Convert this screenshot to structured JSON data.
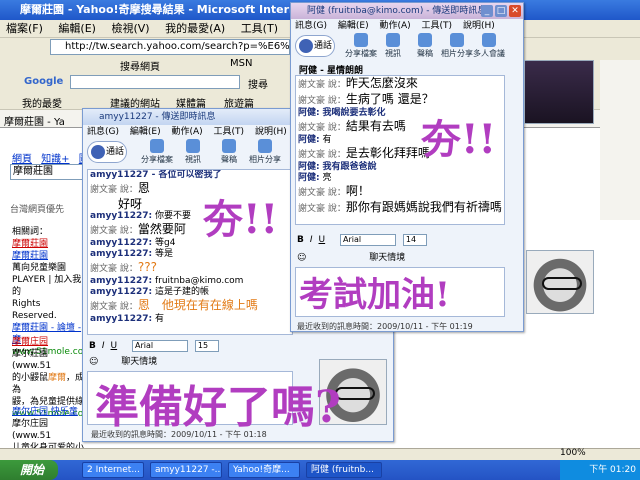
{
  "browser": {
    "title": "摩爾莊園 - Yahoo!奇摩搜尋結果 - Microsoft Internet Explorer",
    "menu": [
      "檔案(F)",
      "編輯(E)",
      "檢視(V)",
      "我的最愛(A)",
      "工具(T)"
    ],
    "address": "http://tw.search.yahoo.com/search?p=%E6%91%A9%E7",
    "search_label": "搜尋網頁",
    "msn_label": "MSN",
    "google_label": "Google",
    "google_search_label": "搜尋",
    "favorites_label": "我的最愛",
    "fav_items": [
      "建議的網站",
      "媒體篇",
      "旅遊篇"
    ],
    "tab_label": "摩爾莊園 - Ya",
    "nav_tabs": [
      "網頁",
      "知識+",
      "圖片"
    ],
    "query_value": "摩爾莊園",
    "related_label": "台灣網頁優先",
    "results": [
      {
        "lines": [
          "相關詞：",
          "摩爾莊園",
          "摩爾莊園",
          "萬向兒童樂園",
          "PLAYER | 加入我的",
          "Rights Reserved.",
          "摩爾莊園 - 論壇 - 摩",
          "www.51mole.com"
        ]
      },
      {
        "lines": [
          "摩爾庄园",
          "摩尔莊園(www.51",
          "的小鼹鼠",
          "摩爾",
          "，成為",
          "鼹，為兒童提供綠",
          "www.51mole.com"
        ]
      },
      {
        "lines": [
          "摩尔庄园 快乐童",
          "摩尔庄园(www.51",
          "儿童化身可爱的小鼹"
        ]
      }
    ],
    "status": ""
  },
  "win1": {
    "title": "amyy11227 - 傳送即時訊息",
    "menu": [
      "訊息(G)",
      "編輯(E)",
      "動作(A)",
      "工具(T)",
      "說明(H)"
    ],
    "call_label": "通話",
    "tools": [
      "分享檔案",
      "視訊",
      "聲稿",
      "相片分享"
    ],
    "chat": [
      {
        "nick": "amyy11227 - 各位可以密我了",
        "msg": ""
      },
      {
        "nick": "謝文豪 說：",
        "msg": "恩"
      },
      {
        "nick": "",
        "msg": "好呀"
      },
      {
        "nick": "amyy11227:",
        "msg": "你要不要"
      },
      {
        "nick": "謝文豪 說：",
        "msg": "當然要阿"
      },
      {
        "nick": "amyy11227:",
        "msg": "等g4"
      },
      {
        "nick": "amyy11227:",
        "msg": "等是"
      },
      {
        "nick": "謝文豪 說：",
        "msg": "???"
      },
      {
        "nick": "amyy11227:",
        "msg": "fruitnba@kimo.com"
      },
      {
        "nick": "amyy11227:",
        "msg": "這是子建的帳"
      },
      {
        "nick": "謝文豪 說：",
        "msg": "恩　他現在有在線上嗎"
      },
      {
        "nick": "amyy11227:",
        "msg": "有"
      }
    ],
    "font": "Arial",
    "size": "15",
    "emote_label": "聊天情境",
    "last_msg": "最近收到的訊息時間：2009/10/11 - 下午 01:18",
    "handwriting_main": "夯!!",
    "handwriting_bottom": "準備好了嗎?"
  },
  "win2": {
    "title": "阿健 (fruitnba@kimo.com) - 傳送即時訊息",
    "menu": [
      "訊息(G)",
      "編輯(E)",
      "動作(A)",
      "工具(T)",
      "說明(H)"
    ],
    "call_label": "通話",
    "tools": [
      "分享檔案",
      "視訊",
      "聲稿",
      "相片分享",
      "多人會議"
    ],
    "to_label": "阿健 - 星情朗朗",
    "chat": [
      {
        "nick": "謝文豪 說：",
        "msg": "昨天怎麼沒來"
      },
      {
        "nick": "謝文豪 說：",
        "msg": "生病了嗎  還是？"
      },
      {
        "nick": "阿健:",
        "msg": "我喝說要去彰化"
      },
      {
        "nick": "謝文豪 說：",
        "msg": "結果有去嗎"
      },
      {
        "nick": "阿健:",
        "msg": "有"
      },
      {
        "nick": "謝文豪 說：",
        "msg": "是去彰化拜拜嗎"
      },
      {
        "nick": "阿健:",
        "msg": "我有跟爸爸說"
      },
      {
        "nick": "阿健:",
        "msg": "亮"
      },
      {
        "nick": "謝文豪 說：",
        "msg": "啊！"
      },
      {
        "nick": "謝文豪 說：",
        "msg": "那你有跟媽媽說我們有祈禱嗎"
      }
    ],
    "font": "Arial",
    "size": "14",
    "emote_label": "聊天情境",
    "last_msg": "最近收到的訊息時間：2009/10/11 - 下午 01:19",
    "handwriting_main": "夯!!",
    "handwriting_bottom": "考試加油!"
  },
  "taskbar": {
    "start": "開始",
    "tasks": [
      "2 Internet...",
      "amyy11227 -...",
      "Yahoo!奇摩...",
      "阿健 (fruitnb..."
    ],
    "tray_zoom": "100%",
    "time": "下午 01:20"
  },
  "colors": {
    "handwriting": "#b13dc0",
    "title_bar": "#1f57c9"
  }
}
